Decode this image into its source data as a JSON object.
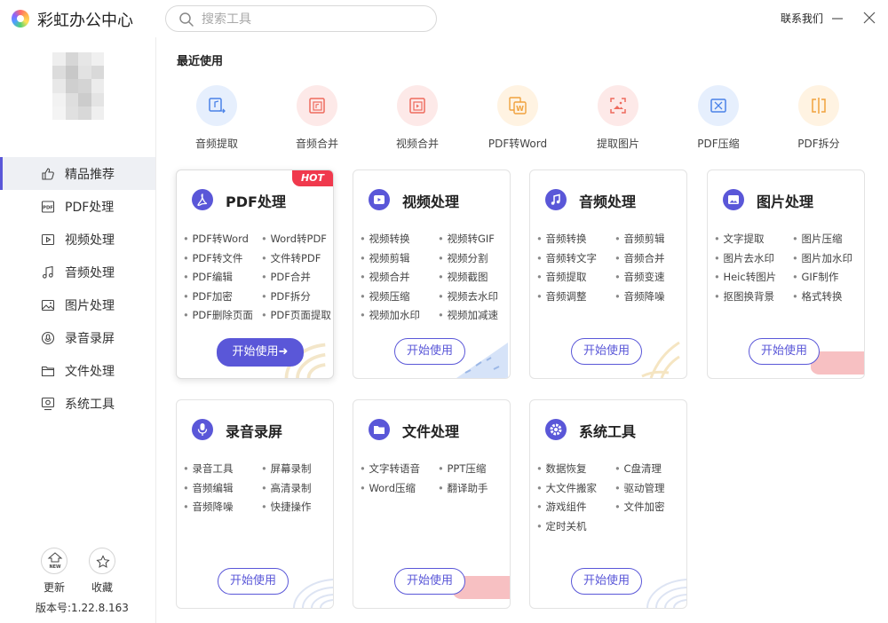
{
  "app": {
    "title": "彩虹办公中心",
    "contact": "联系我们"
  },
  "search": {
    "placeholder": "搜索工具"
  },
  "sidebar": {
    "items": [
      {
        "label": "精品推荐",
        "icon": "thumbs-up-icon",
        "active": true
      },
      {
        "label": "PDF处理",
        "icon": "pdf-icon"
      },
      {
        "label": "视频处理",
        "icon": "video-icon"
      },
      {
        "label": "音频处理",
        "icon": "music-icon"
      },
      {
        "label": "图片处理",
        "icon": "image-icon"
      },
      {
        "label": "录音录屏",
        "icon": "mic-icon"
      },
      {
        "label": "文件处理",
        "icon": "folder-icon"
      },
      {
        "label": "系统工具",
        "icon": "monitor-icon"
      }
    ],
    "tools": [
      {
        "label": "更新",
        "icon": "update-new-icon"
      },
      {
        "label": "收藏",
        "icon": "star-icon"
      }
    ],
    "version": "版本号:1.22.8.163"
  },
  "recent": {
    "title": "最近使用",
    "items": [
      {
        "label": "音频提取",
        "icon": "audio-extract-icon",
        "bg": "#e6effd",
        "fg": "#4a82e8"
      },
      {
        "label": "音频合并",
        "icon": "audio-merge-icon",
        "bg": "#fde9e8",
        "fg": "#ee6a5d"
      },
      {
        "label": "视频合并",
        "icon": "video-merge-icon",
        "bg": "#fde9e8",
        "fg": "#ee6a5d"
      },
      {
        "label": "PDF转Word",
        "icon": "pdf-to-word-icon",
        "bg": "#fff3e2",
        "fg": "#f0a13c"
      },
      {
        "label": "提取图片",
        "icon": "extract-image-icon",
        "bg": "#fde9e8",
        "fg": "#ee6a5d"
      },
      {
        "label": "PDF压缩",
        "icon": "pdf-compress-icon",
        "bg": "#e6effd",
        "fg": "#4a82e8"
      },
      {
        "label": "PDF拆分",
        "icon": "pdf-split-icon",
        "bg": "#fff3e2",
        "fg": "#f0a13c"
      }
    ]
  },
  "cards": [
    {
      "title": "PDF处理",
      "icon": "pdf-icon",
      "hot": "HOT",
      "button": "开始使用➜",
      "features": [
        "PDF转Word",
        "Word转PDF",
        "PDF转文件",
        "文件转PDF",
        "PDF编辑",
        "PDF合并",
        "PDF加密",
        "PDF拆分",
        "PDF删除页面",
        "PDF页面提取"
      ]
    },
    {
      "title": "视频处理",
      "icon": "video-play-icon",
      "button": "开始使用",
      "features": [
        "视频转换",
        "视频转GIF",
        "视频剪辑",
        "视频分割",
        "视频合并",
        "视频截图",
        "视频压缩",
        "视频去水印",
        "视频加水印",
        "视频加减速"
      ]
    },
    {
      "title": "音频处理",
      "icon": "music-note-icon",
      "button": "开始使用",
      "features": [
        "音频转换",
        "音频剪辑",
        "音频转文字",
        "音频合并",
        "音频提取",
        "音频变速",
        "音频调整",
        "音频降噪"
      ]
    },
    {
      "title": "图片处理",
      "icon": "image-icon",
      "button": "开始使用",
      "features": [
        "文字提取",
        "图片压缩",
        "图片去水印",
        "图片加水印",
        "Heic转图片",
        "GIF制作",
        "抠图换背景",
        "格式转换"
      ]
    },
    {
      "title": "录音录屏",
      "icon": "mic-icon",
      "button": "开始使用",
      "features": [
        "录音工具",
        "屏幕录制",
        "音频编辑",
        "高清录制",
        "音频降噪",
        "快捷操作"
      ]
    },
    {
      "title": "文件处理",
      "icon": "folder-icon",
      "button": "开始使用",
      "features": [
        "文字转语音",
        "PPT压缩",
        "Word压缩",
        "翻译助手"
      ]
    },
    {
      "title": "系统工具",
      "icon": "settings-icon",
      "button": "开始使用",
      "features": [
        "数据恢复",
        "C盘清理",
        "大文件搬家",
        "驱动管理",
        "游戏组件",
        "文件加密",
        "定时关机"
      ]
    }
  ],
  "colors": {
    "accent": "#5a57d8",
    "hot": "#f0394d"
  }
}
